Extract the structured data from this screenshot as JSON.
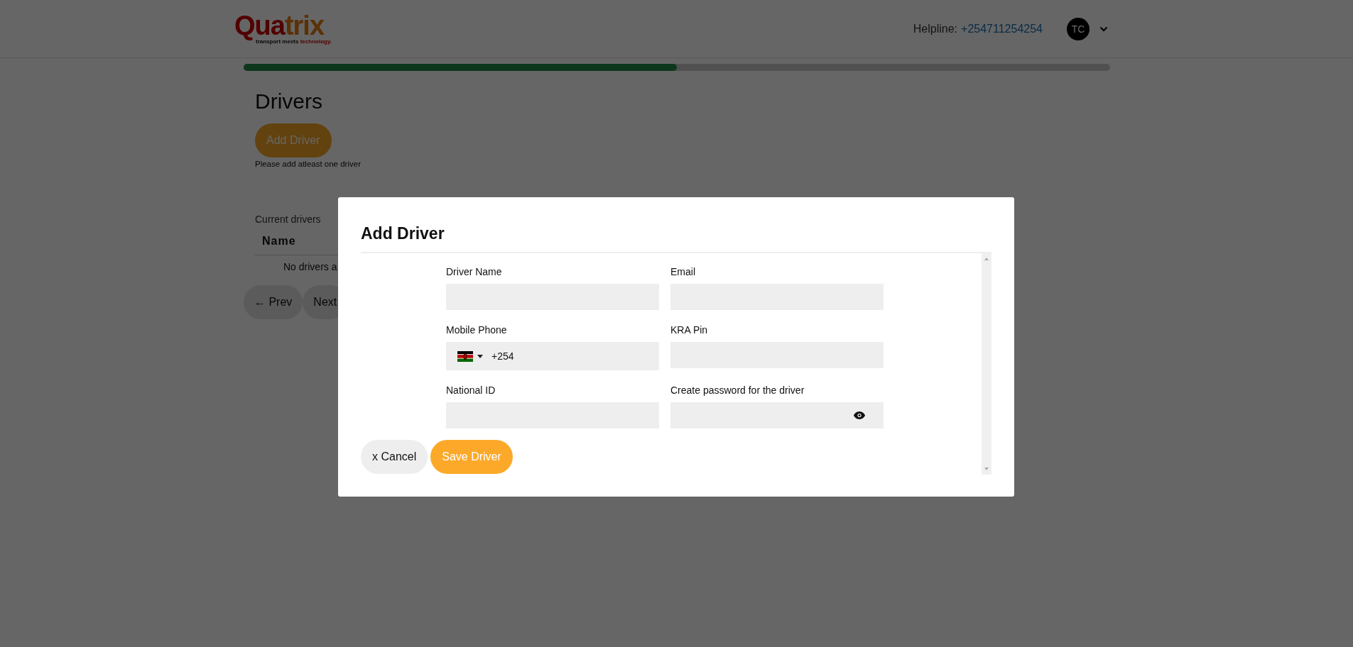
{
  "header": {
    "logo": {
      "first": "Qua",
      "second": "trix",
      "tagline": "transport meets",
      "tagline_accent": "technology."
    },
    "helpline_label": "Helpline:",
    "helpline_number": "+254711254254",
    "avatar_initials": "TC"
  },
  "progress": {
    "level": 0.5
  },
  "page": {
    "title": "Drivers",
    "add_button": "Add Driver",
    "hint": "Please add atleast one driver",
    "section_label": "Current drivers",
    "table": {
      "columns": [
        "Name"
      ],
      "empty_text": "No drivers a"
    },
    "pagination": [
      "← Prev",
      "Next"
    ]
  },
  "modal": {
    "title": "Add Driver",
    "fields": [
      {
        "label": "Driver Name",
        "kind": "text"
      },
      {
        "label": "Email",
        "kind": "text"
      },
      {
        "label": "Mobile Phone",
        "kind": "phone",
        "value": "+254"
      },
      {
        "label": "KRA Pin",
        "kind": "text"
      },
      {
        "label": "National ID",
        "kind": "text"
      },
      {
        "label": "Create password for the driver",
        "kind": "password"
      }
    ],
    "buttons": [
      {
        "label": "x Cancel",
        "kind": "secondary"
      },
      {
        "label": "Save Driver",
        "kind": "primary"
      }
    ]
  }
}
